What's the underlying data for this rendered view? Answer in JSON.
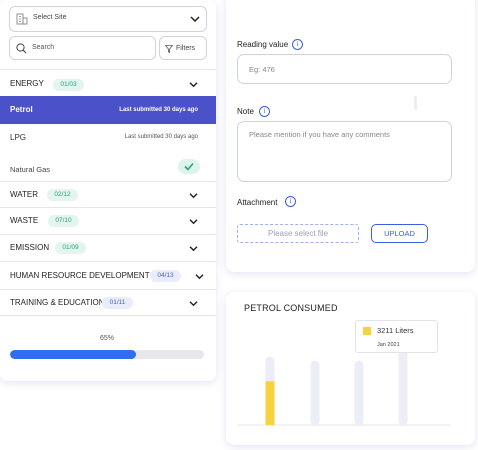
{
  "site_select": {
    "label": "Select Site"
  },
  "search": {
    "placeholder": "Search",
    "filters_label": "Filters"
  },
  "categories": {
    "energy": {
      "name": "ENERGY",
      "count": "01/03"
    },
    "water": {
      "name": "WATER",
      "count": "02/12"
    },
    "waste": {
      "name": "WASTE",
      "count": "07/10"
    },
    "emission": {
      "name": "EMISSION",
      "count": "01/09"
    },
    "hrd": {
      "name": "HUMAN RESOURCE DEVELOPMENT",
      "count": "04/13"
    },
    "training": {
      "name": "TRAINING & EDUCATION",
      "count": "01/11"
    }
  },
  "energy_items": [
    {
      "name": "Petrol",
      "meta": "Last submitted 30 days ago",
      "active": true
    },
    {
      "name": "LPG",
      "meta": "Last submitted 30 days ago",
      "active": false
    },
    {
      "name": "Natural Gas",
      "meta": "",
      "completed": true
    }
  ],
  "progress": {
    "label": "65%",
    "value": 0.65
  },
  "form": {
    "reading_label": "Reading value",
    "reading_placeholder": "Eg: 476",
    "note_label": "Note",
    "note_placeholder": "Please mention if you have any comments",
    "attachment_label": "Attachment",
    "file_placeholder": "Please select file",
    "upload_label": "UPLOAD"
  },
  "chart_data": {
    "type": "bar",
    "title": "PETROL CONSUMED",
    "categories": [
      "",
      "",
      "",
      ""
    ],
    "values": [
      3211,
      0,
      0,
      0
    ],
    "background_max": [
      5000,
      4700,
      4700,
      5500
    ],
    "ylim": [
      0,
      5500
    ],
    "tooltip": {
      "value": "3211 Liters",
      "date": "Jan 2021"
    },
    "colors": {
      "highlight": "#f7d23c",
      "track": "#eceef6"
    }
  },
  "colors": {
    "accent": "#4b52c9",
    "progress": "#2f6ef0",
    "link": "#3a5fe0",
    "success": "#2aa37a"
  }
}
